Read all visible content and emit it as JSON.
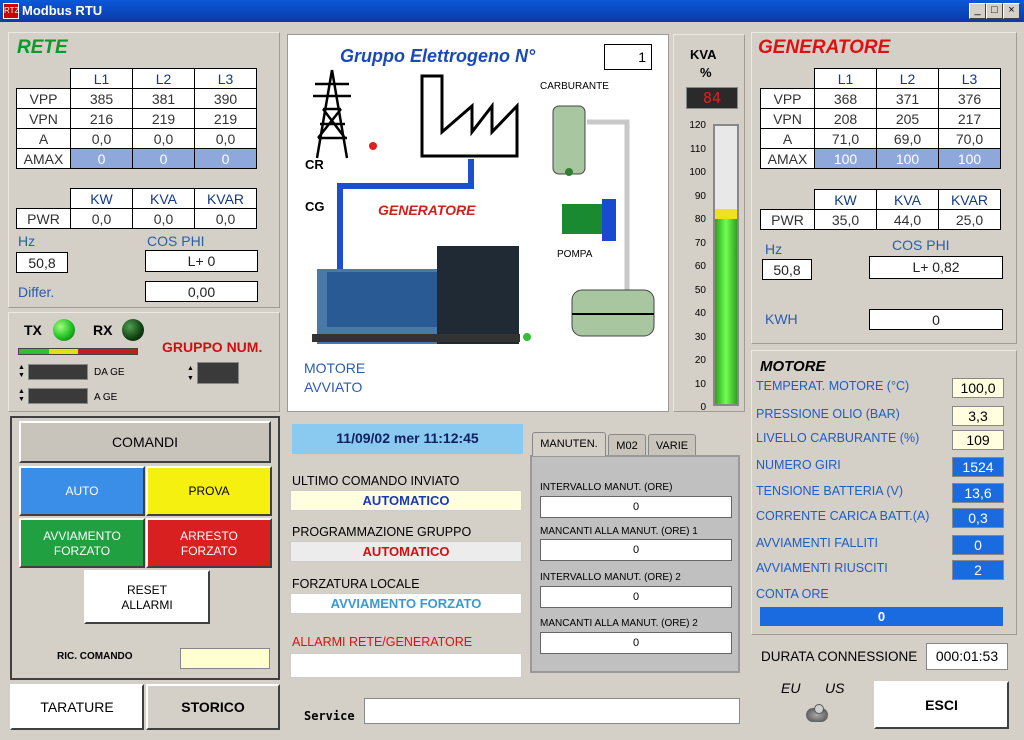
{
  "window": {
    "title": "Modbus RTU",
    "app_icon": "RTZ",
    "minimize": "_",
    "maximize": "□",
    "close": "×"
  },
  "rete": {
    "title": "RETE",
    "cols": [
      "L1",
      "L2",
      "L3"
    ],
    "rows": [
      {
        "label": "VPP",
        "values": [
          "385",
          "381",
          "390"
        ]
      },
      {
        "label": "VPN",
        "values": [
          "216",
          "219",
          "219"
        ]
      },
      {
        "label": "A",
        "values": [
          "0,0",
          "0,0",
          "0,0"
        ]
      },
      {
        "label": "AMAX",
        "values": [
          "0",
          "0",
          "0"
        ]
      }
    ],
    "pwr_cols": [
      "KW",
      "KVA",
      "KVAR"
    ],
    "pwr_label": "PWR",
    "pwr_values": [
      "0,0",
      "0,0",
      "0,0"
    ],
    "hz_label": "Hz",
    "hz_value": "50,8",
    "cosphi_label": "COS PHI",
    "cosphi_value": "L+ 0",
    "differ_label": "Differ.",
    "differ_value": "0,00"
  },
  "comm": {
    "tx": "TX",
    "rx": "RX",
    "gruppo_num": "GRUPPO NUM.",
    "da_ge": "DA GE",
    "a_ge": "A GE",
    "tx_color": "#20d020",
    "rx_color": "#105010"
  },
  "comandi": {
    "title": "COMANDI",
    "auto": "AUTO",
    "prova": "PROVA",
    "avviamento": "AVVIAMENTO FORZATO",
    "arresto": "ARRESTO FORZATO",
    "reset": "RESET ALLARMI",
    "ric_comando": "RIC. COMANDO"
  },
  "bottom": {
    "tarature": "TARATURE",
    "storico": "STORICO",
    "service": "Service"
  },
  "schema": {
    "title": "Gruppo Elettrogeno N°",
    "number": "1",
    "cr": "CR",
    "cg": "CG",
    "generatore": "GENERATORE",
    "carburante": "CARBURANTE",
    "pompa": "POMPA",
    "motore_state": "MOTORE AVVIATO"
  },
  "kva": {
    "label": "KVA",
    "unit": "%",
    "display": "84",
    "ticks": [
      "120",
      "110",
      "100",
      "90",
      "80",
      "70",
      "60",
      "50",
      "40",
      "30",
      "20",
      "10",
      "0"
    ],
    "level_pct": 84,
    "max": 120
  },
  "center": {
    "datetime": "11/09/02  mer 11:12:45",
    "ultimo_label": "ULTIMO COMANDO INVIATO",
    "ultimo_value": "AUTOMATICO",
    "prog_label": "PROGRAMMAZIONE GRUPPO",
    "prog_value": "AUTOMATICO",
    "forz_label": "FORZATURA LOCALE",
    "forz_value": "AVVIAMENTO FORZATO",
    "allarmi_label": "ALLARMI RETE/GENERATORE",
    "allarmi_value": ""
  },
  "tabs": {
    "items": [
      "MANUTEN.",
      "M02",
      "VARIE"
    ],
    "fields": [
      {
        "label": "INTERVALLO MANUT. (ORE)",
        "value": "0"
      },
      {
        "label": "MANCANTI ALLA MANUT. (ORE) 1",
        "value": "0"
      },
      {
        "label": "INTERVALLO MANUT. (ORE) 2",
        "value": "0"
      },
      {
        "label": "MANCANTI ALLA MANUT. (ORE) 2",
        "value": "0"
      }
    ]
  },
  "generatore": {
    "title": "GENERATORE",
    "cols": [
      "L1",
      "L2",
      "L3"
    ],
    "rows": [
      {
        "label": "VPP",
        "values": [
          "368",
          "371",
          "376"
        ]
      },
      {
        "label": "VPN",
        "values": [
          "208",
          "205",
          "217"
        ]
      },
      {
        "label": "A",
        "values": [
          "71,0",
          "69,0",
          "70,0"
        ]
      },
      {
        "label": "AMAX",
        "values": [
          "100",
          "100",
          "100"
        ]
      }
    ],
    "pwr_cols": [
      "KW",
      "KVA",
      "KVAR"
    ],
    "pwr_label": "PWR",
    "pwr_values": [
      "35,0",
      "44,0",
      "25,0"
    ],
    "hz_label": "Hz",
    "hz_value": "50,8",
    "cosphi_label": "COS PHI",
    "cosphi_value": "L+ 0,82",
    "kwh_label": "KWH",
    "kwh_value": "0"
  },
  "motore": {
    "title": "MOTORE",
    "items": [
      {
        "label": "TEMPERAT. MOTORE (°C)",
        "value": "100,0"
      },
      {
        "label": "PRESSIONE OLIO (BAR)",
        "value": "3,3"
      },
      {
        "label": "LIVELLO CARBURANTE (%)",
        "value": "109"
      },
      {
        "label": "NUMERO GIRI",
        "value": "1524"
      },
      {
        "label": "TENSIONE BATTERIA (V)",
        "value": "13,6"
      },
      {
        "label": "CORRENTE CARICA BATT.(A)",
        "value": "0,3"
      },
      {
        "label": "AVVIAMENTI FALLITI",
        "value": "0"
      },
      {
        "label": "AVVIAMENTI RIUSCITI",
        "value": "2"
      }
    ],
    "conta_ore_label": "CONTA ORE",
    "conta_ore_value": "0"
  },
  "connessione": {
    "label": "DURATA CONNESSIONE",
    "value": "000:01:53",
    "eu": "EU",
    "us": "US",
    "esci": "ESCI"
  }
}
